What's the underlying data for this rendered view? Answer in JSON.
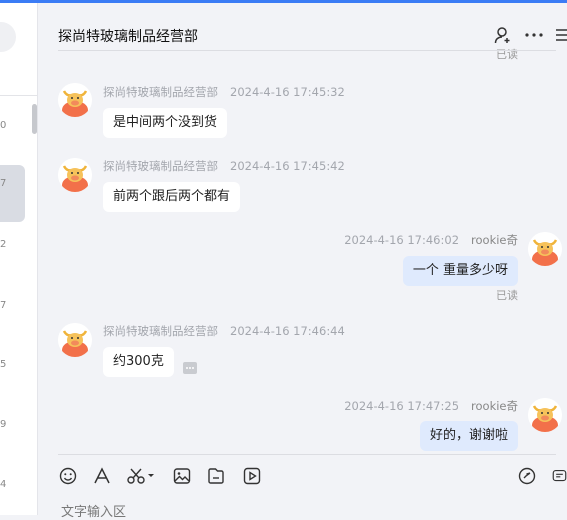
{
  "window": {
    "accent": "#3b7cf5"
  },
  "sidebar": {
    "row_numbers": [
      "0",
      "7",
      "2",
      "7",
      "5",
      "9",
      "4"
    ]
  },
  "chat": {
    "title": "探尚特玻璃制品经营部",
    "header_icons": [
      "add-contact-icon",
      "more-dots-icon",
      "menu-list-icon"
    ],
    "top_read_label": "已读",
    "messages": [
      {
        "sender": "探尚特玻璃制品经营部",
        "time": "2024-4-16 17:45:32",
        "text": "是中间两个没到货",
        "mine": false
      },
      {
        "sender": "探尚特玻璃制品经营部",
        "time": "2024-4-16 17:45:42",
        "text": "前两个跟后两个都有",
        "mine": false
      },
      {
        "sender": "rookie奇",
        "time": "2024-4-16 17:46:02",
        "text": "一个 重量多少呀",
        "mine": true,
        "read": "已读"
      },
      {
        "sender": "探尚特玻璃制品经营部",
        "time": "2024-4-16 17:46:44",
        "text": "约300克",
        "mine": false
      },
      {
        "sender": "rookie奇",
        "time": "2024-4-16 17:47:25",
        "text": "好的，谢谢啦",
        "mine": true
      }
    ]
  },
  "toolbar": {
    "tools": [
      "emoji-icon",
      "font-icon",
      "scissors-icon",
      "image-icon",
      "file-icon",
      "video-icon",
      "quick-reply-icon",
      "chat-history-icon"
    ]
  },
  "input": {
    "placeholder": "文字输入区"
  }
}
